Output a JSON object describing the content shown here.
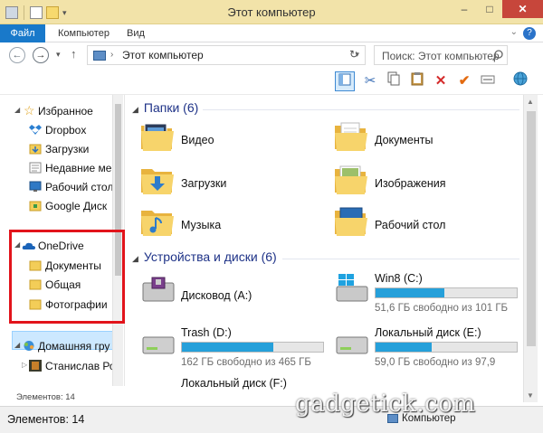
{
  "window": {
    "title": "Этот компьютер",
    "minimize": "–",
    "maximize": "□",
    "close": "✕"
  },
  "ribbon": {
    "tabs": [
      "Файл",
      "Компьютер",
      "Вид"
    ],
    "help": "?"
  },
  "address": {
    "path": "Этот компьютер",
    "search_placeholder": "Поиск: Этот компьютер"
  },
  "nav": {
    "favorites": "Избранное",
    "favorites_items": [
      "Dropbox",
      "Загрузки",
      "Недавние ме",
      "Рабочий стол",
      "Google Диск"
    ],
    "onedrive": "OneDrive",
    "onedrive_items": [
      "Документы",
      "Общая",
      "Фотографии"
    ],
    "homegroup": "Домашняя гру",
    "homegroup_user": "Станислав Ро",
    "count_small": "Элементов: 14"
  },
  "folders_group": {
    "title": "Папки (6)",
    "items": [
      "Видео",
      "Документы",
      "Загрузки",
      "Изображения",
      "Музыка",
      "Рабочий стол"
    ]
  },
  "drives_group": {
    "title": "Устройства и диски (6)",
    "drives": [
      {
        "name": "Дисковод (A:)"
      },
      {
        "name": "Win8 (C:)",
        "free": "51,6 ГБ свободно из 101 ГБ",
        "used_fraction": 0.49
      },
      {
        "name": "Trash (D:)",
        "free": "162 ГБ свободно из 465 ГБ",
        "used_fraction": 0.65
      },
      {
        "name": "Локальный диск (E:)",
        "free": "59,0 ГБ свободно из 97,9",
        "used_fraction": 0.4
      },
      {
        "name": "Локальный диск (F:)"
      }
    ]
  },
  "status": {
    "count": "Элементов: 14",
    "location": "Компьютер"
  },
  "watermark": "gadgetick.com",
  "colors": {
    "accent": "#1979ca",
    "title_bar": "#f2e3a9",
    "selection": "#cce8ff",
    "highlight_box": "#e2141b",
    "drive_bar": "#26a0da"
  }
}
